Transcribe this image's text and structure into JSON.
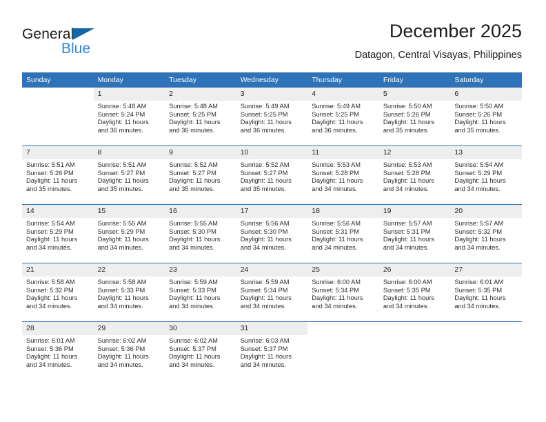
{
  "brand": {
    "name_part1": "General",
    "name_part2": "Blue",
    "triangle_color": "#1565a8",
    "blue_text_color": "#2e86d4"
  },
  "header": {
    "title": "December 2025",
    "subtitle": "Datagon, Central Visayas, Philippines"
  },
  "theme": {
    "header_bg": "#2e73b8",
    "daynum_bg": "#eeeeee",
    "week_divider": "#2e73b8"
  },
  "weekday_headers": [
    "Sunday",
    "Monday",
    "Tuesday",
    "Wednesday",
    "Thursday",
    "Friday",
    "Saturday"
  ],
  "weeks": [
    [
      {
        "day": "",
        "sunrise": "",
        "sunset": "",
        "daylight_line1": "",
        "daylight_line2": ""
      },
      {
        "day": "1",
        "sunrise": "Sunrise: 5:48 AM",
        "sunset": "Sunset: 5:24 PM",
        "daylight_line1": "Daylight: 11 hours",
        "daylight_line2": "and 36 minutes."
      },
      {
        "day": "2",
        "sunrise": "Sunrise: 5:48 AM",
        "sunset": "Sunset: 5:25 PM",
        "daylight_line1": "Daylight: 11 hours",
        "daylight_line2": "and 36 minutes."
      },
      {
        "day": "3",
        "sunrise": "Sunrise: 5:49 AM",
        "sunset": "Sunset: 5:25 PM",
        "daylight_line1": "Daylight: 11 hours",
        "daylight_line2": "and 36 minutes."
      },
      {
        "day": "4",
        "sunrise": "Sunrise: 5:49 AM",
        "sunset": "Sunset: 5:25 PM",
        "daylight_line1": "Daylight: 11 hours",
        "daylight_line2": "and 36 minutes."
      },
      {
        "day": "5",
        "sunrise": "Sunrise: 5:50 AM",
        "sunset": "Sunset: 5:26 PM",
        "daylight_line1": "Daylight: 11 hours",
        "daylight_line2": "and 35 minutes."
      },
      {
        "day": "6",
        "sunrise": "Sunrise: 5:50 AM",
        "sunset": "Sunset: 5:26 PM",
        "daylight_line1": "Daylight: 11 hours",
        "daylight_line2": "and 35 minutes."
      }
    ],
    [
      {
        "day": "7",
        "sunrise": "Sunrise: 5:51 AM",
        "sunset": "Sunset: 5:26 PM",
        "daylight_line1": "Daylight: 11 hours",
        "daylight_line2": "and 35 minutes."
      },
      {
        "day": "8",
        "sunrise": "Sunrise: 5:51 AM",
        "sunset": "Sunset: 5:27 PM",
        "daylight_line1": "Daylight: 11 hours",
        "daylight_line2": "and 35 minutes."
      },
      {
        "day": "9",
        "sunrise": "Sunrise: 5:52 AM",
        "sunset": "Sunset: 5:27 PM",
        "daylight_line1": "Daylight: 11 hours",
        "daylight_line2": "and 35 minutes."
      },
      {
        "day": "10",
        "sunrise": "Sunrise: 5:52 AM",
        "sunset": "Sunset: 5:27 PM",
        "daylight_line1": "Daylight: 11 hours",
        "daylight_line2": "and 35 minutes."
      },
      {
        "day": "11",
        "sunrise": "Sunrise: 5:53 AM",
        "sunset": "Sunset: 5:28 PM",
        "daylight_line1": "Daylight: 11 hours",
        "daylight_line2": "and 34 minutes."
      },
      {
        "day": "12",
        "sunrise": "Sunrise: 5:53 AM",
        "sunset": "Sunset: 5:28 PM",
        "daylight_line1": "Daylight: 11 hours",
        "daylight_line2": "and 34 minutes."
      },
      {
        "day": "13",
        "sunrise": "Sunrise: 5:54 AM",
        "sunset": "Sunset: 5:29 PM",
        "daylight_line1": "Daylight: 11 hours",
        "daylight_line2": "and 34 minutes."
      }
    ],
    [
      {
        "day": "14",
        "sunrise": "Sunrise: 5:54 AM",
        "sunset": "Sunset: 5:29 PM",
        "daylight_line1": "Daylight: 11 hours",
        "daylight_line2": "and 34 minutes."
      },
      {
        "day": "15",
        "sunrise": "Sunrise: 5:55 AM",
        "sunset": "Sunset: 5:29 PM",
        "daylight_line1": "Daylight: 11 hours",
        "daylight_line2": "and 34 minutes."
      },
      {
        "day": "16",
        "sunrise": "Sunrise: 5:55 AM",
        "sunset": "Sunset: 5:30 PM",
        "daylight_line1": "Daylight: 11 hours",
        "daylight_line2": "and 34 minutes."
      },
      {
        "day": "17",
        "sunrise": "Sunrise: 5:56 AM",
        "sunset": "Sunset: 5:30 PM",
        "daylight_line1": "Daylight: 11 hours",
        "daylight_line2": "and 34 minutes."
      },
      {
        "day": "18",
        "sunrise": "Sunrise: 5:56 AM",
        "sunset": "Sunset: 5:31 PM",
        "daylight_line1": "Daylight: 11 hours",
        "daylight_line2": "and 34 minutes."
      },
      {
        "day": "19",
        "sunrise": "Sunrise: 5:57 AM",
        "sunset": "Sunset: 5:31 PM",
        "daylight_line1": "Daylight: 11 hours",
        "daylight_line2": "and 34 minutes."
      },
      {
        "day": "20",
        "sunrise": "Sunrise: 5:57 AM",
        "sunset": "Sunset: 5:32 PM",
        "daylight_line1": "Daylight: 11 hours",
        "daylight_line2": "and 34 minutes."
      }
    ],
    [
      {
        "day": "21",
        "sunrise": "Sunrise: 5:58 AM",
        "sunset": "Sunset: 5:32 PM",
        "daylight_line1": "Daylight: 11 hours",
        "daylight_line2": "and 34 minutes."
      },
      {
        "day": "22",
        "sunrise": "Sunrise: 5:58 AM",
        "sunset": "Sunset: 5:33 PM",
        "daylight_line1": "Daylight: 11 hours",
        "daylight_line2": "and 34 minutes."
      },
      {
        "day": "23",
        "sunrise": "Sunrise: 5:59 AM",
        "sunset": "Sunset: 5:33 PM",
        "daylight_line1": "Daylight: 11 hours",
        "daylight_line2": "and 34 minutes."
      },
      {
        "day": "24",
        "sunrise": "Sunrise: 5:59 AM",
        "sunset": "Sunset: 5:34 PM",
        "daylight_line1": "Daylight: 11 hours",
        "daylight_line2": "and 34 minutes."
      },
      {
        "day": "25",
        "sunrise": "Sunrise: 6:00 AM",
        "sunset": "Sunset: 5:34 PM",
        "daylight_line1": "Daylight: 11 hours",
        "daylight_line2": "and 34 minutes."
      },
      {
        "day": "26",
        "sunrise": "Sunrise: 6:00 AM",
        "sunset": "Sunset: 5:35 PM",
        "daylight_line1": "Daylight: 11 hours",
        "daylight_line2": "and 34 minutes."
      },
      {
        "day": "27",
        "sunrise": "Sunrise: 6:01 AM",
        "sunset": "Sunset: 5:35 PM",
        "daylight_line1": "Daylight: 11 hours",
        "daylight_line2": "and 34 minutes."
      }
    ],
    [
      {
        "day": "28",
        "sunrise": "Sunrise: 6:01 AM",
        "sunset": "Sunset: 5:36 PM",
        "daylight_line1": "Daylight: 11 hours",
        "daylight_line2": "and 34 minutes."
      },
      {
        "day": "29",
        "sunrise": "Sunrise: 6:02 AM",
        "sunset": "Sunset: 5:36 PM",
        "daylight_line1": "Daylight: 11 hours",
        "daylight_line2": "and 34 minutes."
      },
      {
        "day": "30",
        "sunrise": "Sunrise: 6:02 AM",
        "sunset": "Sunset: 5:37 PM",
        "daylight_line1": "Daylight: 11 hours",
        "daylight_line2": "and 34 minutes."
      },
      {
        "day": "31",
        "sunrise": "Sunrise: 6:03 AM",
        "sunset": "Sunset: 5:37 PM",
        "daylight_line1": "Daylight: 11 hours",
        "daylight_line2": "and 34 minutes."
      },
      {
        "day": "",
        "sunrise": "",
        "sunset": "",
        "daylight_line1": "",
        "daylight_line2": ""
      },
      {
        "day": "",
        "sunrise": "",
        "sunset": "",
        "daylight_line1": "",
        "daylight_line2": ""
      },
      {
        "day": "",
        "sunrise": "",
        "sunset": "",
        "daylight_line1": "",
        "daylight_line2": ""
      }
    ]
  ]
}
